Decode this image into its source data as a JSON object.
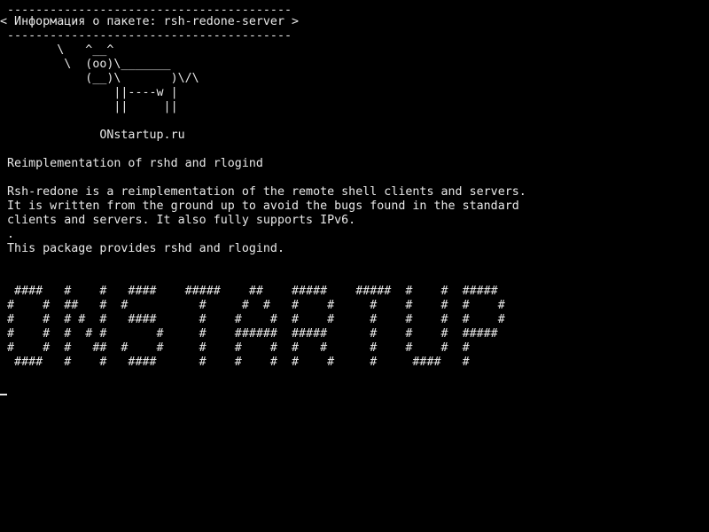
{
  "terminal": {
    "lines": [
      " ----------------------------------------",
      "< Информация о пакете: rsh-redone-server >",
      " ----------------------------------------",
      "        \\   ^__^",
      "         \\  (oo)\\_______",
      "            (__)\\       )\\/\\",
      "                ||----w |",
      "                ||     ||",
      "",
      "              ONstartup.ru",
      "",
      " Reimplementation of rshd and rlogind",
      "",
      " Rsh-redone is a reimplementation of the remote shell clients and servers.",
      " It is written from the ground up to avoid the bugs found in the standard",
      " clients and servers. It also fully supports IPv6.",
      " .",
      " This package provides rshd and rlogind.",
      "",
      "",
      "  ####   #    #   ####    #####    ##    #####    #####  #    #  #####",
      " #    #  ##   #  #          #     #  #   #    #     #    #    #  #    #",
      " #    #  # #  #   ####      #    #    #  #    #     #    #    #  #    #",
      " #    #  #  # #       #     #    ######  #####      #    #    #  #####",
      " #    #  #   ##  #    #     #    #    #  #   #      #    #    #  #",
      "  ####   #    #   ####      #    #    #  #    #     #     ####   #"
    ],
    "colors": {
      "background": "#000000",
      "foreground": "#e8e8e8"
    },
    "cursor": "underscore-cursor"
  }
}
